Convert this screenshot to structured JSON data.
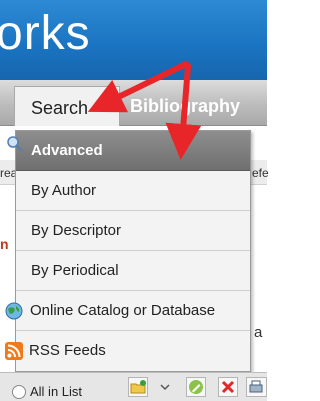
{
  "header": {
    "title_fragment": "orks"
  },
  "nav": {
    "tabs": [
      {
        "label": "Search"
      },
      {
        "label": "Bibliography"
      }
    ]
  },
  "background": {
    "row1_left": "rea",
    "row1_right": "efe",
    "red_fragment": "n",
    "right_fragment": "a"
  },
  "menu": {
    "items": [
      {
        "label": "Advanced"
      },
      {
        "label": "By Author"
      },
      {
        "label": "By Descriptor"
      },
      {
        "label": "By Periodical"
      },
      {
        "label": "Online Catalog or Database"
      },
      {
        "label": "RSS Feeds"
      }
    ]
  },
  "toolbar": {
    "radio_label": "All in List"
  },
  "colors": {
    "banner": "#1a73c0",
    "active_item": "#7a7a7a",
    "arrow": "#e8262a",
    "rss": "#f07a1a",
    "globe": "#3a9d3f"
  }
}
